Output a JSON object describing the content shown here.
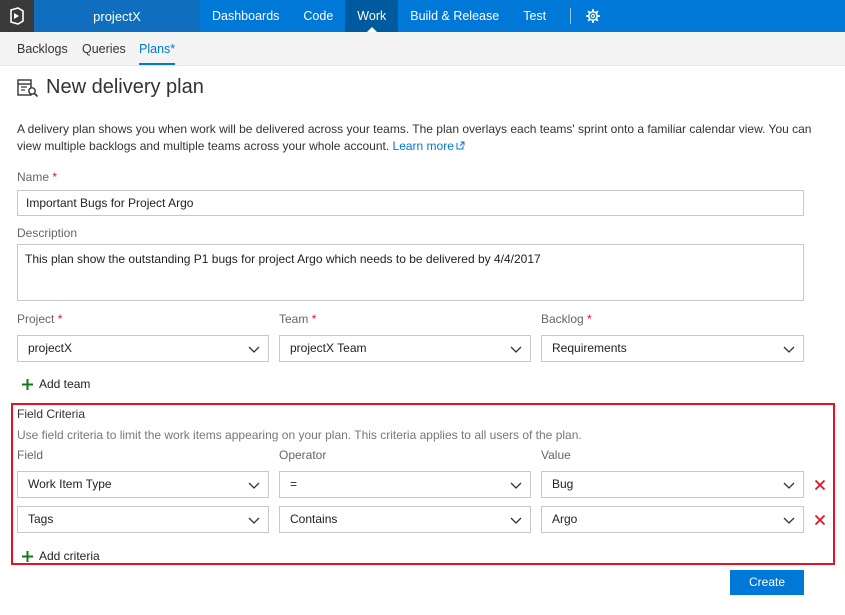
{
  "topbar": {
    "project": "projectX",
    "nav": [
      "Dashboards",
      "Code",
      "Work",
      "Build & Release",
      "Test"
    ],
    "active": "Work"
  },
  "subnav": {
    "items": [
      "Backlogs",
      "Queries",
      "Plans*"
    ],
    "active": "Plans*"
  },
  "page": {
    "title": "New delivery plan",
    "description": "A delivery plan shows you when work will be delivered across your teams. The plan overlays each teams' sprint onto a familiar calendar view. You can view multiple backlogs and multiple teams across your whole account.",
    "learn_more": "Learn more"
  },
  "form": {
    "name_label": "Name",
    "required_mark": "*",
    "name_value": "Important Bugs for Project Argo",
    "description_label": "Description",
    "description_value": "This plan show the outstanding P1 bugs for project Argo which needs to be delivered by 4/4/2017",
    "project_label": "Project",
    "team_label": "Team",
    "backlog_label": "Backlog",
    "project_value": "projectX",
    "team_value": "projectX Team",
    "backlog_value": "Requirements",
    "add_team": "Add team"
  },
  "criteria": {
    "title": "Field Criteria",
    "hint": "Use field criteria to limit the work items appearing on your plan. This criteria applies to all users of the plan.",
    "field_label": "Field",
    "operator_label": "Operator",
    "value_label": "Value",
    "rows": [
      {
        "field": "Work Item Type",
        "operator": "=",
        "value": "Bug"
      },
      {
        "field": "Tags",
        "operator": "Contains",
        "value": "Argo"
      }
    ],
    "add_criteria": "Add criteria"
  },
  "actions": {
    "create": "Create"
  },
  "colors": {
    "accent": "#0078d7",
    "danger": "#e81123",
    "add_green": "#107c10"
  }
}
